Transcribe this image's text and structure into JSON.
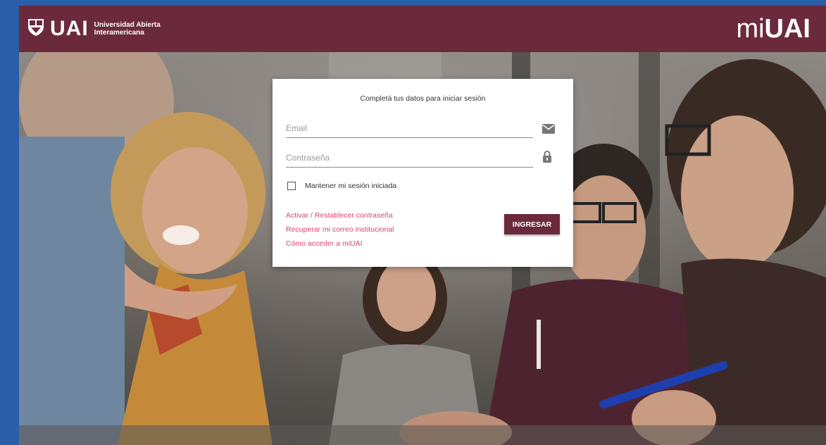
{
  "header": {
    "brand_name": "UAI",
    "brand_sub_line1": "Universidad Abierta",
    "brand_sub_line2": "Interamericana",
    "app_logo_prefix": "mi",
    "app_logo_suffix": "UAI",
    "color": "#6b2a3c"
  },
  "login": {
    "title": "Completá tus datos para iniciar sesión",
    "email_placeholder": "Email",
    "email_value": "",
    "password_placeholder": "Contraseña",
    "password_value": "",
    "remember_label": "Mantener mi sesión iniciada",
    "remember_checked": false,
    "links": [
      "Activar / Restablecer contraseña",
      "Recuperar mi correo institucional",
      "Cómo acceder a miUAI"
    ],
    "submit_label": "INGRESAR",
    "link_color": "#d9407b"
  },
  "icons": {
    "email": "envelope-icon",
    "password": "lock-icon"
  }
}
